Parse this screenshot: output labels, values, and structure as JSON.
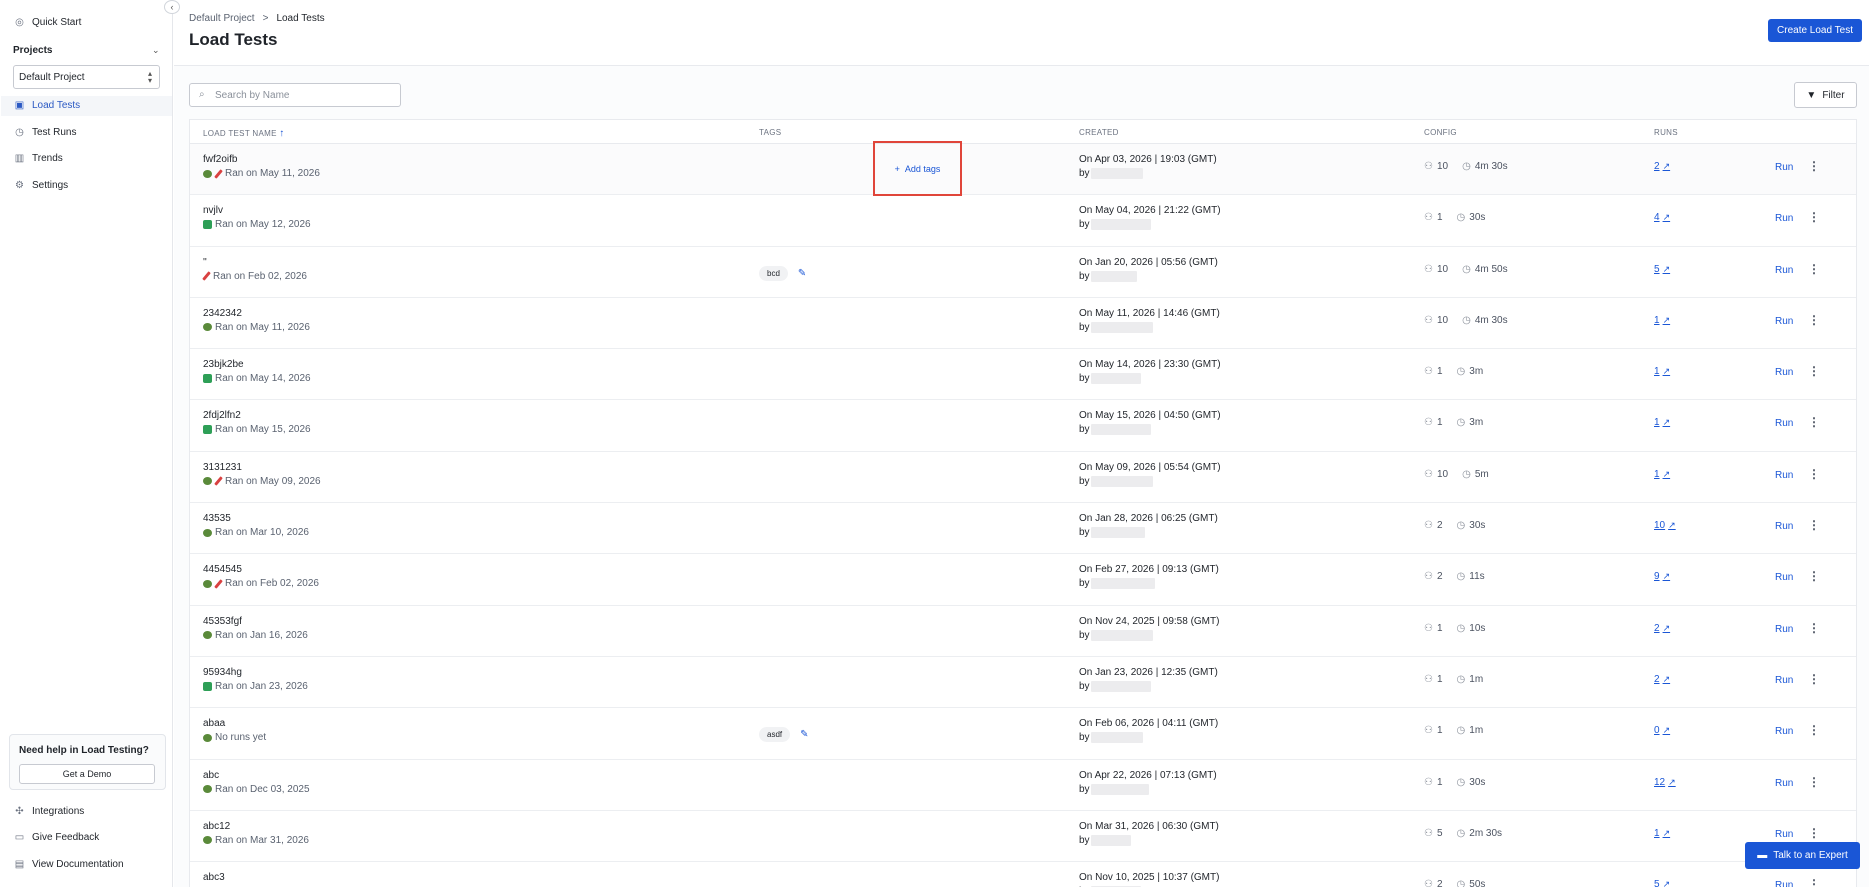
{
  "sidebar": {
    "quick_start": "Quick Start",
    "projects_label": "Projects",
    "project_select": "Default Project",
    "nav": [
      {
        "label": "Load Tests",
        "icon": "load-tests-icon"
      },
      {
        "label": "Test Runs",
        "icon": "clock-icon"
      },
      {
        "label": "Trends",
        "icon": "bar-chart-icon"
      },
      {
        "label": "Settings",
        "icon": "gear-icon"
      }
    ],
    "help_title": "Need help in Load Testing?",
    "demo_button": "Get a Demo",
    "bottom": [
      {
        "label": "Integrations"
      },
      {
        "label": "Give Feedback"
      },
      {
        "label": "View Documentation"
      }
    ]
  },
  "header": {
    "breadcrumb_project": "Default Project",
    "breadcrumb_sep": ">",
    "breadcrumb_current": "Load Tests",
    "title": "Load Tests",
    "create_button": "Create Load Test"
  },
  "toolbar": {
    "search_placeholder": "Search by Name",
    "filter_label": "Filter"
  },
  "table": {
    "columns": {
      "name": "LOAD TEST NAME",
      "tags": "TAGS",
      "created": "CREATED",
      "config": "CONFIG",
      "runs": "RUNS"
    },
    "add_tags_label": "Add tags",
    "run_label": "Run",
    "by_label": "by",
    "rows": [
      {
        "name": "fwf2oifb",
        "status": "Ran on May 11, 2026",
        "status_icons": [
          "flag",
          "fail"
        ],
        "tags": [],
        "add_tags": true,
        "created": "On Apr 03, 2026 | 19:03 (GMT)",
        "users": "10",
        "duration": "4m 30s",
        "runs": "2"
      },
      {
        "name": "nvjlv",
        "status": "Ran on May 12, 2026",
        "status_icons": [
          "ok"
        ],
        "tags": [],
        "created": "On May 04, 2026 | 21:22 (GMT)",
        "users": "1",
        "duration": "30s",
        "runs": "4"
      },
      {
        "name": "''",
        "status": "Ran on Feb 02, 2026",
        "status_icons": [
          "fail"
        ],
        "tags": [
          "bcd"
        ],
        "created": "On Jan 20, 2026 | 05:56 (GMT)",
        "users": "10",
        "duration": "4m 50s",
        "runs": "5"
      },
      {
        "name": "2342342",
        "status": "Ran on May 11, 2026",
        "status_icons": [
          "flag"
        ],
        "tags": [],
        "created": "On May 11, 2026 | 14:46 (GMT)",
        "users": "10",
        "duration": "4m 30s",
        "runs": "1"
      },
      {
        "name": "23bjk2be",
        "status": "Ran on May 14, 2026",
        "status_icons": [
          "ok"
        ],
        "tags": [],
        "created": "On May 14, 2026 | 23:30 (GMT)",
        "users": "1",
        "duration": "3m",
        "runs": "1"
      },
      {
        "name": "2fdj2lfn2",
        "status": "Ran on May 15, 2026",
        "status_icons": [
          "ok"
        ],
        "tags": [],
        "created": "On May 15, 2026 | 04:50 (GMT)",
        "users": "1",
        "duration": "3m",
        "runs": "1"
      },
      {
        "name": "3131231",
        "status": "Ran on May 09, 2026",
        "status_icons": [
          "flag",
          "fail"
        ],
        "tags": [],
        "created": "On May 09, 2026 | 05:54 (GMT)",
        "users": "10",
        "duration": "5m",
        "runs": "1"
      },
      {
        "name": "43535",
        "status": "Ran on Mar 10, 2026",
        "status_icons": [
          "flag"
        ],
        "tags": [],
        "created": "On Jan 28, 2026 | 06:25 (GMT)",
        "users": "2",
        "duration": "30s",
        "runs": "10"
      },
      {
        "name": "4454545",
        "status": "Ran on Feb 02, 2026",
        "status_icons": [
          "flag",
          "fail"
        ],
        "tags": [],
        "created": "On Feb 27, 2026 | 09:13 (GMT)",
        "users": "2",
        "duration": "11s",
        "runs": "9"
      },
      {
        "name": "45353fgf",
        "status": "Ran on Jan 16, 2026",
        "status_icons": [
          "flag"
        ],
        "tags": [],
        "created": "On Nov 24, 2025 | 09:58 (GMT)",
        "users": "1",
        "duration": "10s",
        "runs": "2"
      },
      {
        "name": "95934hg",
        "status": "Ran on Jan 23, 2026",
        "status_icons": [
          "ok"
        ],
        "tags": [],
        "created": "On Jan 23, 2026 | 12:35 (GMT)",
        "users": "1",
        "duration": "1m",
        "runs": "2"
      },
      {
        "name": "abaa",
        "status": "No runs yet",
        "status_icons": [
          "flag"
        ],
        "tags": [
          "asdf"
        ],
        "created": "On Feb 06, 2026 | 04:11 (GMT)",
        "users": "1",
        "duration": "1m",
        "runs": "0"
      },
      {
        "name": "abc",
        "status": "Ran on Dec 03, 2025",
        "status_icons": [
          "flag"
        ],
        "tags": [],
        "created": "On Apr 22, 2026 | 07:13 (GMT)",
        "users": "1",
        "duration": "30s",
        "runs": "12"
      },
      {
        "name": "abc12",
        "status": "Ran on Mar 31, 2026",
        "status_icons": [
          "flag"
        ],
        "tags": [],
        "created": "On Mar 31, 2026 | 06:30 (GMT)",
        "users": "5",
        "duration": "2m 30s",
        "runs": "1"
      },
      {
        "name": "abc3",
        "status": "",
        "status_icons": [],
        "tags": [],
        "created": "On Nov 10, 2025 | 10:37 (GMT)",
        "users": "2",
        "duration": "50s",
        "runs": "5"
      }
    ]
  },
  "expert_button": "Talk to an Expert",
  "colors": {
    "accent": "#1a56d6",
    "highlight_box": "#e0453a",
    "ok": "#2e9f57",
    "fail": "#d94141"
  }
}
